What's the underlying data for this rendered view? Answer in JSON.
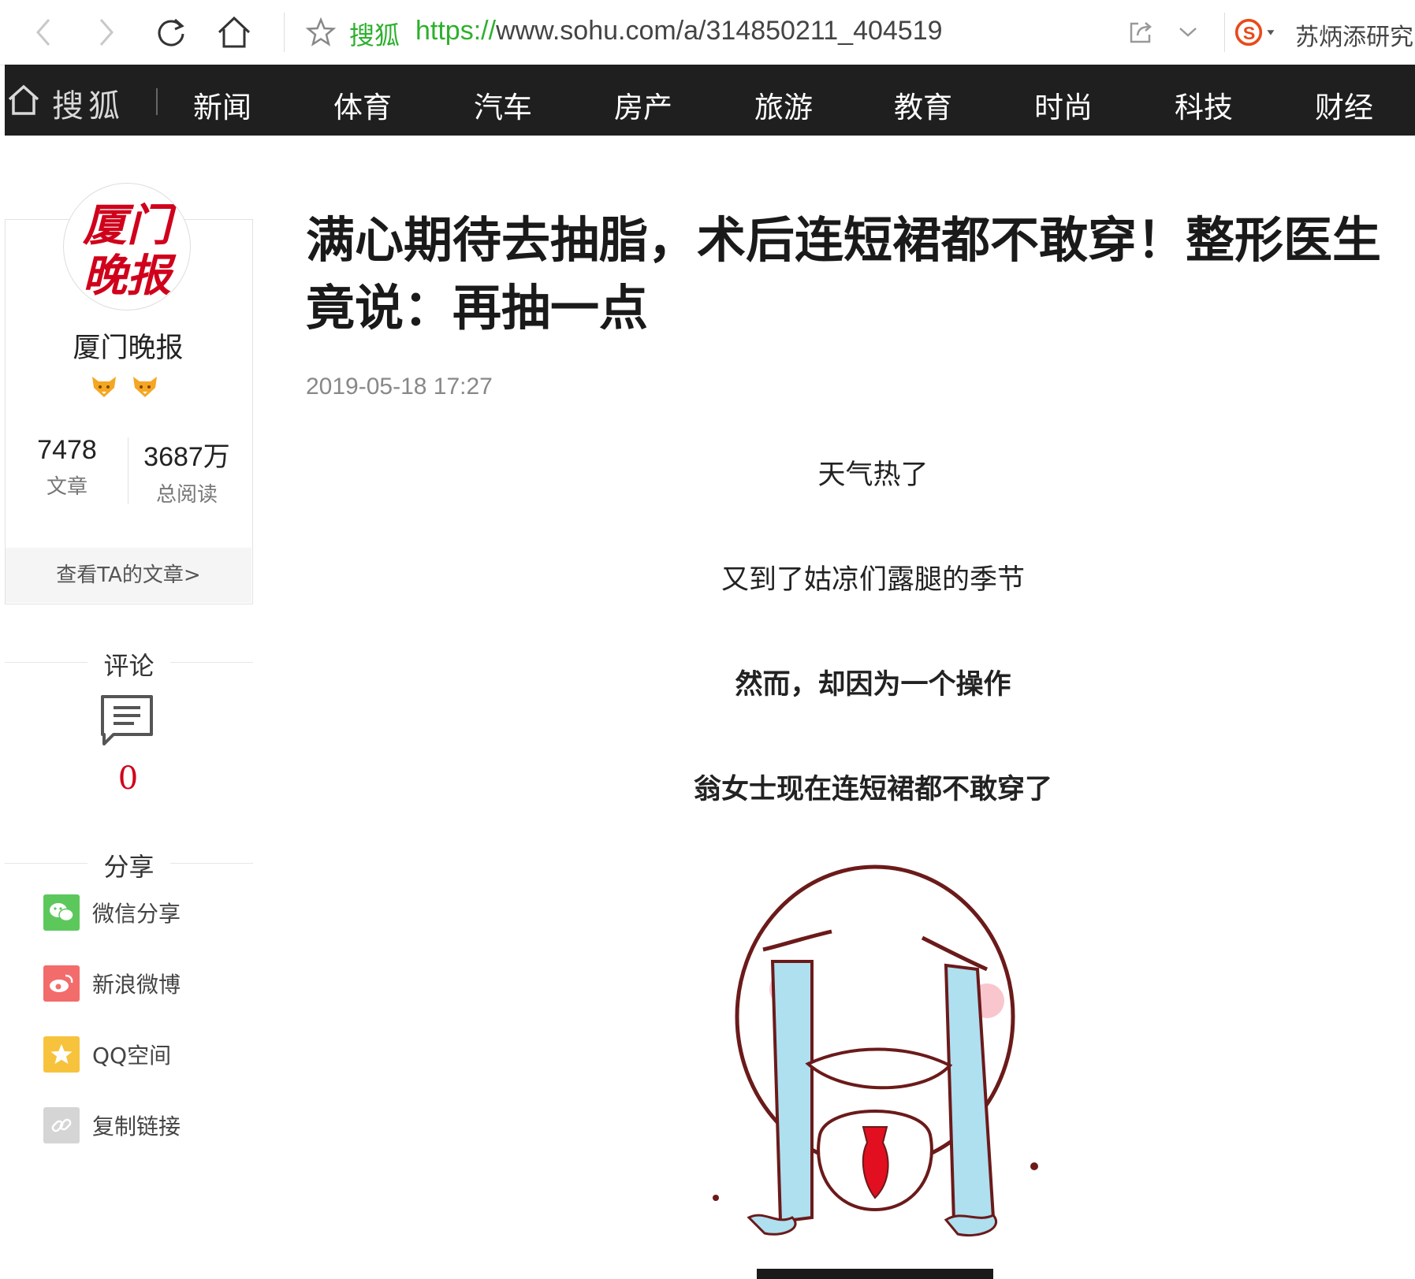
{
  "browser": {
    "site_name": "搜狐",
    "url_scheme": "https://",
    "url_rest": "www.sohu.com/a/314850211_404519",
    "profile_name": "苏炳添研究"
  },
  "nav": {
    "brand": "搜狐",
    "items": [
      "新闻",
      "体育",
      "汽车",
      "房产",
      "旅游",
      "教育",
      "时尚",
      "科技",
      "财经"
    ]
  },
  "author": {
    "avatar_text": [
      "厦门",
      "晚报"
    ],
    "name": "厦门晚报",
    "articles_count": "7478",
    "articles_label": "文章",
    "reads_count": "3687万",
    "reads_label": "总阅读",
    "view_articles": "查看TA的文章>"
  },
  "comments": {
    "heading": "评论",
    "count": "0"
  },
  "share": {
    "heading": "分享",
    "items": [
      {
        "label": "微信分享",
        "icon": "wechat-icon",
        "color": "#5cc85c"
      },
      {
        "label": "新浪微博",
        "icon": "weibo-icon",
        "color": "#f36c6c"
      },
      {
        "label": "QQ空间",
        "icon": "qzone-icon",
        "color": "#f7c33d"
      },
      {
        "label": "复制链接",
        "icon": "link-icon",
        "color": "#d5d5d5"
      }
    ]
  },
  "article": {
    "title": "满心期待去抽脂，术后连短裙都不敢穿！整形医生竟说：再抽一点",
    "time": "2019-05-18 17:27",
    "paragraphs": [
      {
        "text": "天气热了",
        "bold": false
      },
      {
        "text": "又到了姑凉们露腿的季节",
        "bold": false
      },
      {
        "text": "然而，却因为一个操作",
        "bold": true
      },
      {
        "text": "翁女士现在连短裙都不敢穿了",
        "bold": true
      }
    ]
  },
  "colors": {
    "nav_bg": "#1f1f1f",
    "accent_green": "#2db02d",
    "comment_red": "#d0021b",
    "avatar_red": "#d0021b"
  }
}
